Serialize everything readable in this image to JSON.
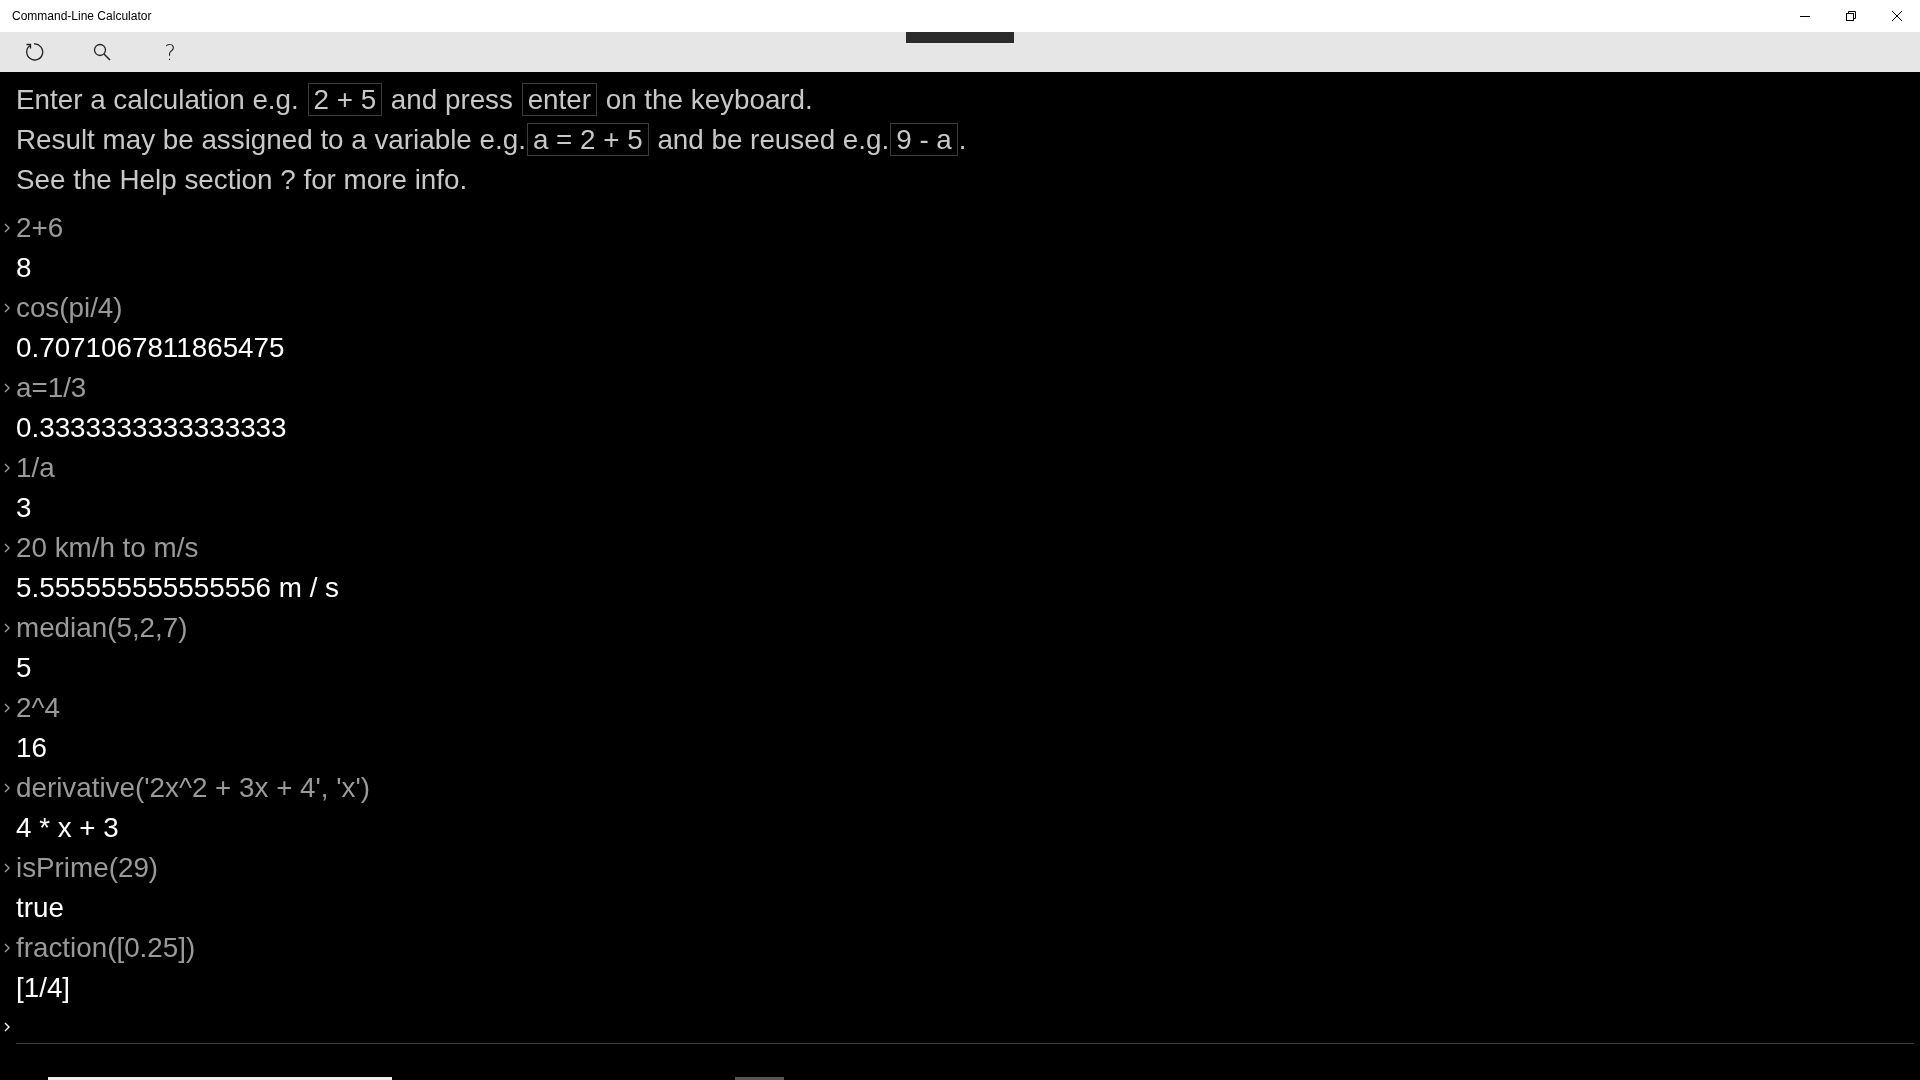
{
  "window": {
    "title": "Command-Line Calculator"
  },
  "toolbar": [
    {
      "kind": "refresh"
    },
    {
      "kind": "search"
    },
    {
      "kind": "help",
      "label": "?"
    }
  ],
  "intro": [
    [
      {
        "kind": "text",
        "text": "Enter a calculation e.g. "
      },
      {
        "kind": "code",
        "text": "2 + 5"
      },
      {
        "kind": "text",
        "text": " and press "
      },
      {
        "kind": "code",
        "text": "enter"
      },
      {
        "kind": "text",
        "text": " on the keyboard."
      }
    ],
    [
      {
        "kind": "text",
        "text": "Result may be assigned to a variable e.g."
      },
      {
        "kind": "code",
        "text": "a = 2 + 5"
      },
      {
        "kind": "text",
        "text": " and be reused e.g."
      },
      {
        "kind": "code",
        "text": "9 - a"
      },
      {
        "kind": "text",
        "text": "."
      }
    ],
    [
      {
        "kind": "text",
        "text": "See the Help section ? for more info."
      }
    ]
  ],
  "history": [
    {
      "input": "2+6",
      "output": "8"
    },
    {
      "input": "cos(pi/4)",
      "output": "0.7071067811865475"
    },
    {
      "input": "a=1/3",
      "output": "0.3333333333333333"
    },
    {
      "input": "1/a",
      "output": "3"
    },
    {
      "input": "20 km/h to m/s",
      "output": "5.555555555555556 m / s"
    },
    {
      "input": "median(5,2,7)",
      "output": "5"
    },
    {
      "input": "2^4",
      "output": "16"
    },
    {
      "input": "derivative('2x^2 + 3x + 4', 'x')",
      "output": "4 * x + 3"
    },
    {
      "input": "isPrime(29)",
      "output": "true"
    },
    {
      "input": "fraction([0.25])",
      "output": "[1/4]"
    }
  ]
}
